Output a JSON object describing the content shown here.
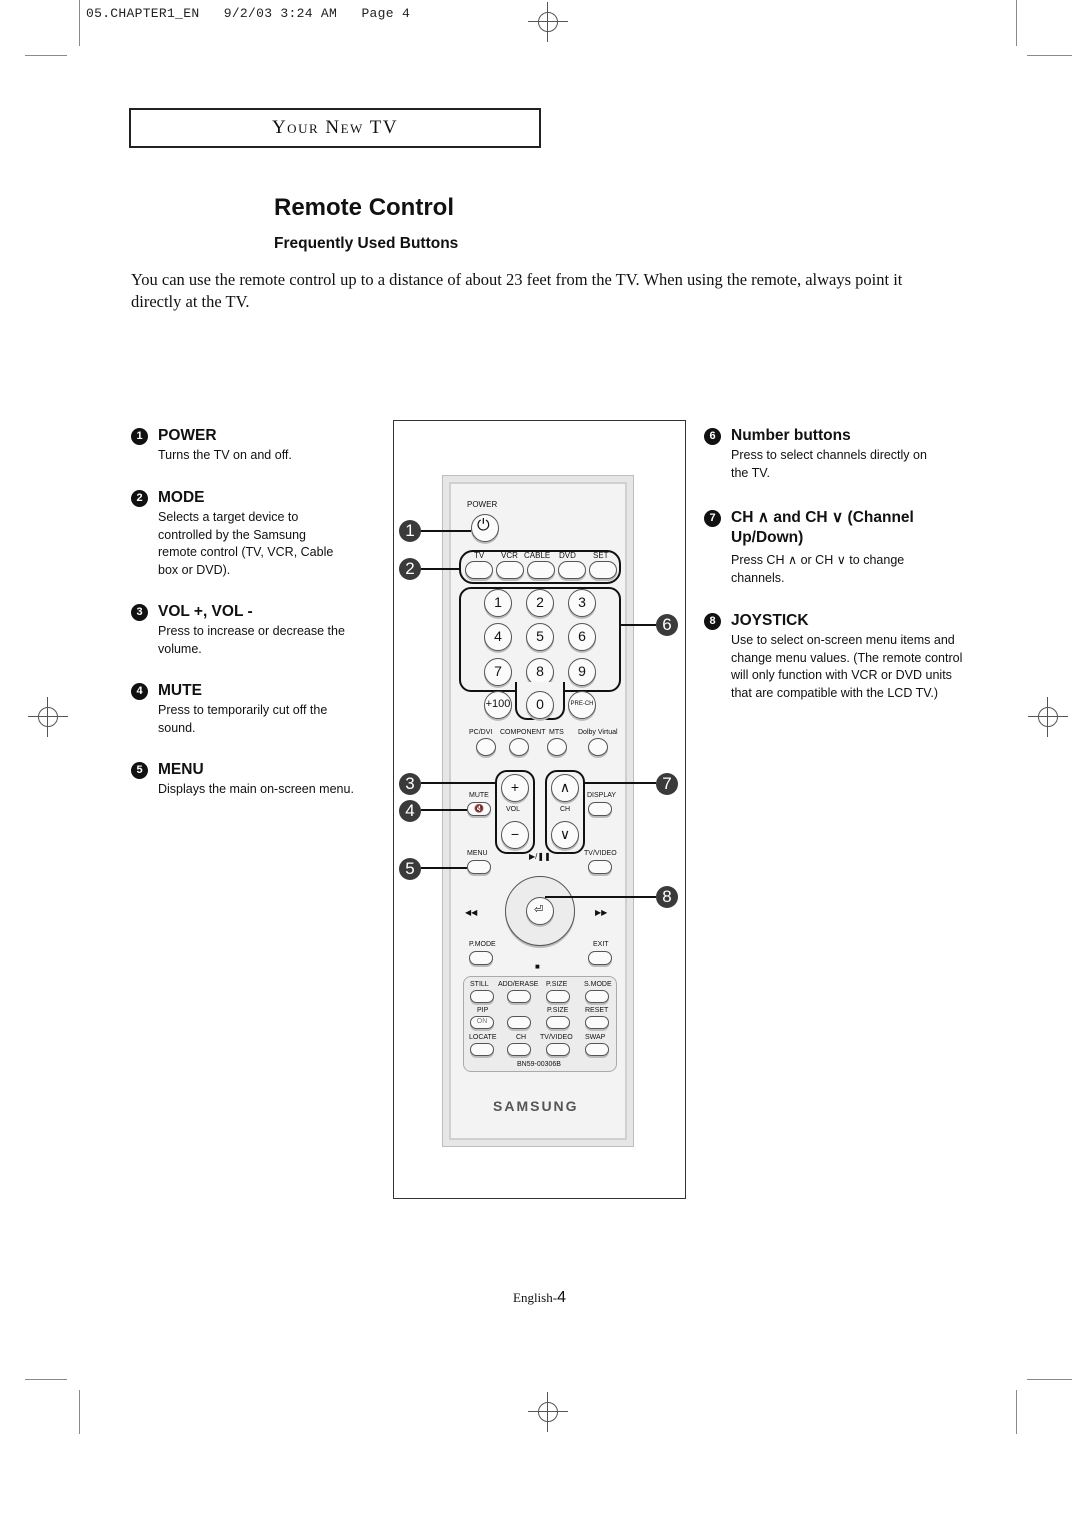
{
  "slug": {
    "text": "05.CHAPTER1_EN   9/2/03 3:24 AM   Page 4"
  },
  "section": {
    "title": "Your New TV"
  },
  "page": {
    "title": "Remote Control",
    "subtitle": "Frequently Used Buttons",
    "intro": "You can use the remote control up to a distance of about 23 feet from the TV. When using the remote, always point it directly at the TV."
  },
  "items": [
    {
      "num": "1",
      "title": "POWER",
      "desc": "Turns the TV on and off."
    },
    {
      "num": "2",
      "title": "MODE",
      "desc": "Selects a target device to controlled by the Samsung remote control (TV, VCR, Cable box or DVD)."
    },
    {
      "num": "3",
      "title": "VOL +, VOL -",
      "desc": "Press to increase or decrease the volume."
    },
    {
      "num": "4",
      "title": "MUTE",
      "desc": "Press to temporarily cut off the sound."
    },
    {
      "num": "5",
      "title": "MENU",
      "desc": "Displays the main on-screen menu."
    },
    {
      "num": "6",
      "title": "Number buttons",
      "desc": "Press to select channels directly on the TV."
    },
    {
      "num": "7",
      "title": "CH ∧ and CH ∨ (Channel Up/Down)",
      "desc": "Press CH ∧ or CH ∨ to change channels."
    },
    {
      "num": "8",
      "title": "JOYSTICK",
      "desc": "Use to select on-screen menu items and change menu values. (The remote control will only function with VCR or DVD units that are compatible with the LCD TV.)"
    }
  ],
  "remote": {
    "power_label": "POWER",
    "mode_labels": [
      "TV",
      "VCR",
      "CABLE",
      "DVD",
      "SET"
    ],
    "numbers": [
      "1",
      "2",
      "3",
      "4",
      "5",
      "6",
      "7",
      "8",
      "9"
    ],
    "plus100": "+100",
    "zero": "0",
    "prech": "PRE-CH",
    "input_labels": [
      "PC/DVI",
      "COMPONENT",
      "MTS",
      "Dolby Virtual"
    ],
    "mute": "MUTE",
    "vol": "VOL",
    "ch": "CH",
    "display": "DISPLAY",
    "menu": "MENU",
    "play_pause": "▶/❚❚",
    "tvvideo": "TV/VIDEO",
    "rew": "◀◀",
    "ff": "▶▶",
    "pmode": "P.MODE",
    "exit": "EXIT",
    "stop": "■",
    "row1": [
      "STILL",
      "ADD/ERASE",
      "P.SIZE",
      "S.MODE"
    ],
    "pip": "PIP",
    "on": "ON",
    "psize2": "P.SIZE",
    "reset": "RESET",
    "row3": [
      "LOCATE",
      "CH",
      "TV/VIDEO",
      "SWAP"
    ],
    "model": "BN59-00306B",
    "brand": "SAMSUNG",
    "callouts": [
      "1",
      "2",
      "3",
      "4",
      "5",
      "6",
      "7",
      "8"
    ]
  },
  "footer": {
    "prefix": "English-",
    "page": "4"
  }
}
